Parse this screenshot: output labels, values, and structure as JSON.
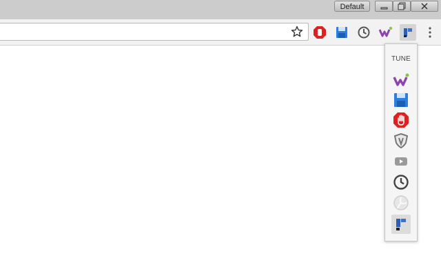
{
  "window": {
    "profile_label": "Default",
    "buttons": [
      "minimize",
      "restore",
      "close"
    ]
  },
  "toolbar": {
    "omnibox_value": "",
    "bookmark_icon": "star-icon",
    "extensions": [
      {
        "name": "adblock-icon",
        "color": "#e02020"
      },
      {
        "name": "save-icon",
        "color": "#2a7de1"
      },
      {
        "name": "clock-icon",
        "color": "#555555"
      },
      {
        "name": "w-extension-icon",
        "color": "#8e44ad"
      },
      {
        "name": "tune-icon",
        "color": "#3a6fd8",
        "active": true
      }
    ],
    "menu_icon": "more-vert-icon"
  },
  "popup": {
    "title": "TUNE",
    "items": [
      {
        "name": "w-extension-icon",
        "color": "#8e44ad"
      },
      {
        "name": "save-icon",
        "color": "#2a7de1"
      },
      {
        "name": "adblock-icon",
        "color": "#e02020"
      },
      {
        "name": "shield-icon",
        "color": "#777777"
      },
      {
        "name": "youtube-icon",
        "color": "#9a9a9a"
      },
      {
        "name": "clock-icon",
        "color": "#444444"
      },
      {
        "name": "disabled-extension-icon",
        "color": "#cfcfcf"
      },
      {
        "name": "tune-icon",
        "color": "#3a6fd8",
        "selected": true
      }
    ]
  }
}
